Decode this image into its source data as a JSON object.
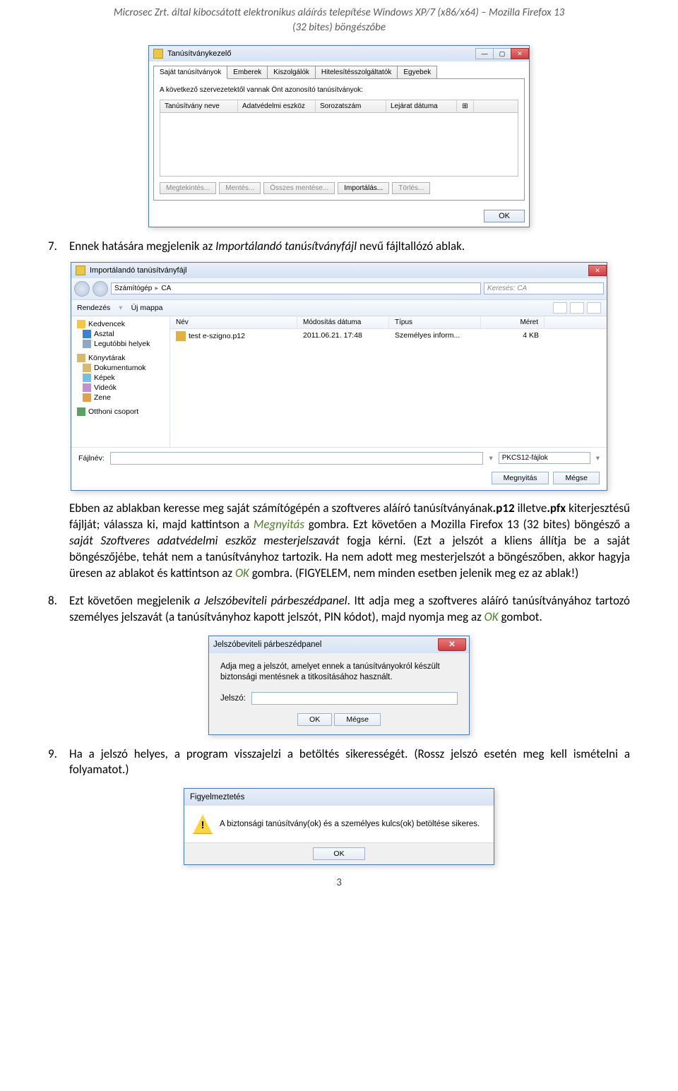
{
  "header": {
    "line1": "Microsec Zrt. által kibocsátott elektronikus aláírás telepítése Windows XP/7 (x86/x64) – Mozilla Firefox 13",
    "line2": "(32 bites) böngészőbe"
  },
  "certmgr": {
    "title": "Tanúsítványkezelő",
    "tabs": [
      "Saját tanúsítványok",
      "Emberek",
      "Kiszolgálók",
      "Hitelesítésszolgáltatók",
      "Egyebek"
    ],
    "desc": "A következő szervezetektől vannak Önt azonosító tanúsítványok:",
    "cols": [
      "Tanúsítvány neve",
      "Adatvédelmi eszköz",
      "Sorozatszám",
      "Lejárat dátuma"
    ],
    "ext": "⊞",
    "buttons": {
      "view": "Megtekintés...",
      "backup": "Mentés...",
      "backupall": "Összes mentése...",
      "import": "Importálás...",
      "delete": "Törlés..."
    },
    "ok": "OK"
  },
  "item7": {
    "num": "7.",
    "text_a": "Ennek hatására megjelenik az ",
    "text_b": "Importálandó tanúsítványfájl",
    "text_c": " nevű fájltallózó ablak."
  },
  "fileopen": {
    "title": "Importálandó tanúsítványfájl",
    "search_placeholder": "Keresés: CA",
    "breadcrumb": [
      "Számítógép",
      "CA"
    ],
    "toolbar": {
      "organize": "Rendezés",
      "newfolder": "Új mappa"
    },
    "sidebar": {
      "favorites": "Kedvencek",
      "desktop": "Asztal",
      "recent": "Legutóbbi helyek",
      "libraries": "Könyvtárak",
      "documents": "Dokumentumok",
      "pictures": "Képek",
      "videos": "Videók",
      "music": "Zene",
      "homegroup": "Otthoni csoport"
    },
    "cols": {
      "name": "Név",
      "modified": "Módosítás dátuma",
      "type": "Típus",
      "size": "Méret"
    },
    "file": {
      "name": "test e-szigno.p12",
      "modified": "2011.06.21. 17:48",
      "type": "Személyes inform...",
      "size": "4 KB"
    },
    "fn_label": "Fájlnév:",
    "filter": "PKCS12-fájlok",
    "open": "Megnyitás",
    "cancel": "Mégse"
  },
  "para7b": {
    "text": "Ebben az ablakban keresse meg saját számítógépén a szoftveres aláíró tanúsítványának",
    "p12": ".p12",
    "illetve": " illetve",
    "pfx": ".pfx",
    "text2": " kiterjesztésű fájlját; válassza ki, majd kattintson a ",
    "megnyitas": "Megnyitás",
    "text3": " gombra. Ezt követően a Mozilla Firefox 13 (32 bites) böngésző a ",
    "sajat": "saját Szoftveres adatvédelmi eszköz mesterjelszavát",
    "text4": " fogja kérni. (Ezt a jelszót a kliens állítja be a saját böngészőjébe, tehát nem a tanúsítványhoz tartozik. Ha nem adott meg mesterjelszót a böngészőben, akkor hagyja üresen az ablakot és kattintson az ",
    "ok": "OK",
    "text5": " gombra. (FIGYELEM, nem minden esetben jelenik meg ez az ablak!)"
  },
  "item8": {
    "num": "8.",
    "text_a": "Ezt követően megjelenik ",
    "text_b": "a Jelszóbeviteli párbeszédpanel",
    "text_c": ". Itt adja meg a szoftveres aláíró tanúsítványához tartozó személyes jelszavát (a tanúsítványhoz kapott jelszót, PIN kódot), majd nyomja meg az ",
    "ok": "OK",
    "text_d": " gombot."
  },
  "pwdlg": {
    "title": "Jelszóbeviteli párbeszédpanel",
    "msg": "Adja meg a jelszót, amelyet ennek a tanúsítványokról készült biztonsági mentésnek a titkosításához használt.",
    "label": "Jelszó:",
    "ok": "OK",
    "cancel": "Mégse"
  },
  "item9": {
    "num": "9.",
    "text": "Ha a jelszó helyes, a program visszajelzi a betöltés sikerességét. (Rossz jelszó esetén meg kell ismételni a folyamatot.)"
  },
  "alert": {
    "title": "Figyelmeztetés",
    "msg": "A biztonsági tanúsítvány(ok) és a személyes kulcs(ok) betöltése sikeres.",
    "ok": "OK"
  },
  "page_number": "3"
}
